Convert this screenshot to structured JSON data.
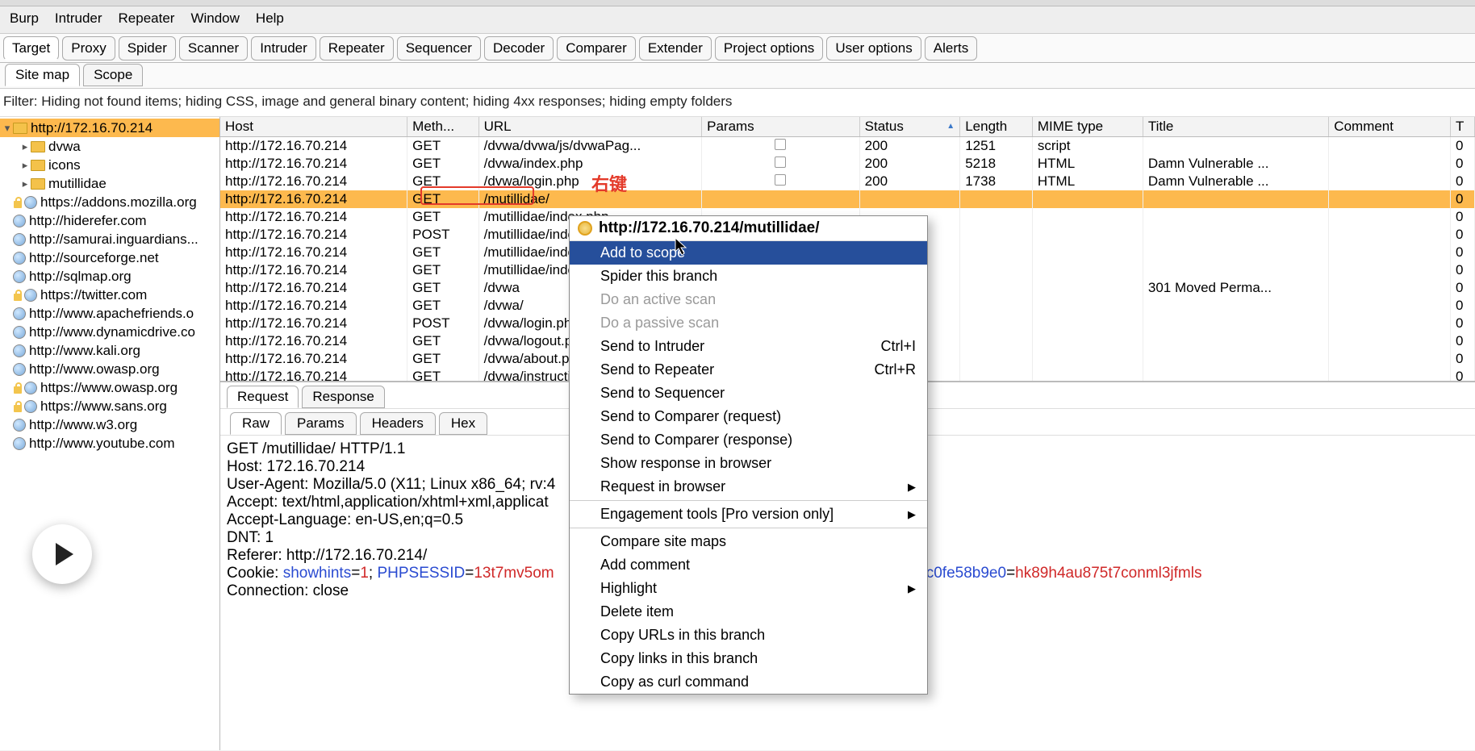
{
  "menu": {
    "burp": "Burp",
    "intruder": "Intruder",
    "repeater": "Repeater",
    "window": "Window",
    "help": "Help"
  },
  "tabs": [
    "Target",
    "Proxy",
    "Spider",
    "Scanner",
    "Intruder",
    "Repeater",
    "Sequencer",
    "Decoder",
    "Comparer",
    "Extender",
    "Project options",
    "User options",
    "Alerts"
  ],
  "active_tab_idx": 0,
  "subtabs": [
    "Site map",
    "Scope"
  ],
  "active_subtab_idx": 0,
  "filter_text": "Filter: Hiding not found items; hiding CSS, image and general binary content; hiding 4xx responses; hiding empty folders",
  "tree": [
    {
      "label": "http://172.16.70.214",
      "icon": "folder",
      "indent": 0,
      "tw": "▾",
      "sel": true,
      "lock": false
    },
    {
      "label": "dvwa",
      "icon": "folder",
      "indent": 1,
      "tw": "▸",
      "sel": false,
      "lock": false
    },
    {
      "label": "icons",
      "icon": "folder",
      "indent": 1,
      "tw": "▸",
      "sel": false,
      "lock": false
    },
    {
      "label": "mutillidae",
      "icon": "folder",
      "indent": 1,
      "tw": "▸",
      "sel": false,
      "lock": false
    },
    {
      "label": "https://addons.mozilla.org",
      "icon": "globe",
      "indent": 0,
      "tw": "",
      "sel": false,
      "lock": true
    },
    {
      "label": "http://hiderefer.com",
      "icon": "globe",
      "indent": 0,
      "tw": "",
      "sel": false,
      "lock": false
    },
    {
      "label": "http://samurai.inguardians...",
      "icon": "globe",
      "indent": 0,
      "tw": "",
      "sel": false,
      "lock": false
    },
    {
      "label": "http://sourceforge.net",
      "icon": "globe",
      "indent": 0,
      "tw": "",
      "sel": false,
      "lock": false
    },
    {
      "label": "http://sqlmap.org",
      "icon": "globe",
      "indent": 0,
      "tw": "",
      "sel": false,
      "lock": false
    },
    {
      "label": "https://twitter.com",
      "icon": "globe",
      "indent": 0,
      "tw": "",
      "sel": false,
      "lock": true
    },
    {
      "label": "http://www.apachefriends.o",
      "icon": "globe",
      "indent": 0,
      "tw": "",
      "sel": false,
      "lock": false
    },
    {
      "label": "http://www.dynamicdrive.co",
      "icon": "globe",
      "indent": 0,
      "tw": "",
      "sel": false,
      "lock": false
    },
    {
      "label": "http://www.kali.org",
      "icon": "globe",
      "indent": 0,
      "tw": "",
      "sel": false,
      "lock": false
    },
    {
      "label": "http://www.owasp.org",
      "icon": "globe",
      "indent": 0,
      "tw": "",
      "sel": false,
      "lock": false
    },
    {
      "label": "https://www.owasp.org",
      "icon": "globe",
      "indent": 0,
      "tw": "",
      "sel": false,
      "lock": true
    },
    {
      "label": "https://www.sans.org",
      "icon": "globe",
      "indent": 0,
      "tw": "",
      "sel": false,
      "lock": true
    },
    {
      "label": "http://www.w3.org",
      "icon": "globe",
      "indent": 0,
      "tw": "",
      "sel": false,
      "lock": false
    },
    {
      "label": "http://www.youtube.com",
      "icon": "globe",
      "indent": 0,
      "tw": "",
      "sel": false,
      "lock": false
    }
  ],
  "columns": {
    "host": "Host",
    "meth": "Meth...",
    "url": "URL",
    "par": "Params",
    "stat": "Status",
    "len": "Length",
    "mime": "MIME type",
    "title": "Title",
    "comment": "Comment",
    "t": "T"
  },
  "rows": [
    {
      "host": "http://172.16.70.214",
      "meth": "GET",
      "url": "/dvwa/dvwa/js/dvwaPag...",
      "par": true,
      "stat": "200",
      "len": "1251",
      "mime": "script",
      "title": "",
      "sel": false,
      "t": "0"
    },
    {
      "host": "http://172.16.70.214",
      "meth": "GET",
      "url": "/dvwa/index.php",
      "par": true,
      "stat": "200",
      "len": "5218",
      "mime": "HTML",
      "title": "Damn Vulnerable ...",
      "sel": false,
      "t": "0"
    },
    {
      "host": "http://172.16.70.214",
      "meth": "GET",
      "url": "/dvwa/login.php",
      "par": true,
      "stat": "200",
      "len": "1738",
      "mime": "HTML",
      "title": "Damn Vulnerable ...",
      "sel": false,
      "t": "0"
    },
    {
      "host": "http://172.16.70.214",
      "meth": "GET",
      "url": "/mutillidae/",
      "par": false,
      "stat": "",
      "len": "",
      "mime": "",
      "title": "",
      "sel": true,
      "t": "0"
    },
    {
      "host": "http://172.16.70.214",
      "meth": "GET",
      "url": "/mutillidae/index.php",
      "par": false,
      "stat": "",
      "len": "",
      "mime": "",
      "title": "",
      "sel": false,
      "t": "0"
    },
    {
      "host": "http://172.16.70.214",
      "meth": "POST",
      "url": "/mutillidae/index.php",
      "par": false,
      "stat": "",
      "len": "",
      "mime": "",
      "title": "",
      "sel": false,
      "t": "0"
    },
    {
      "host": "http://172.16.70.214",
      "meth": "GET",
      "url": "/mutillidae/index.php",
      "par": false,
      "stat": "",
      "len": "",
      "mime": "",
      "title": "",
      "sel": false,
      "t": "0"
    },
    {
      "host": "http://172.16.70.214",
      "meth": "GET",
      "url": "/mutillidae/index.php",
      "par": false,
      "stat": "",
      "len": "",
      "mime": "",
      "title": "",
      "sel": false,
      "t": "0"
    },
    {
      "host": "http://172.16.70.214",
      "meth": "GET",
      "url": "/dvwa",
      "par": false,
      "stat": "",
      "len": "",
      "mime": "",
      "title": "301 Moved Perma...",
      "sel": false,
      "t": "0"
    },
    {
      "host": "http://172.16.70.214",
      "meth": "GET",
      "url": "/dvwa/",
      "par": false,
      "stat": "",
      "len": "",
      "mime": "",
      "title": "",
      "sel": false,
      "t": "0"
    },
    {
      "host": "http://172.16.70.214",
      "meth": "POST",
      "url": "/dvwa/login.php",
      "par": false,
      "stat": "",
      "len": "",
      "mime": "",
      "title": "",
      "sel": false,
      "t": "0"
    },
    {
      "host": "http://172.16.70.214",
      "meth": "GET",
      "url": "/dvwa/logout.php",
      "par": false,
      "stat": "",
      "len": "",
      "mime": "",
      "title": "",
      "sel": false,
      "t": "0"
    },
    {
      "host": "http://172.16.70.214",
      "meth": "GET",
      "url": "/dvwa/about.php",
      "par": false,
      "stat": "",
      "len": "",
      "mime": "",
      "title": "",
      "sel": false,
      "t": "0"
    },
    {
      "host": "http://172.16.70.214",
      "meth": "GET",
      "url": "/dvwa/instructions.p",
      "par": false,
      "stat": "",
      "len": "",
      "mime": "",
      "title": "",
      "sel": false,
      "t": "0"
    }
  ],
  "reqtabs": [
    "Request",
    "Response"
  ],
  "active_reqtab_idx": 0,
  "rawtabs": [
    "Raw",
    "Params",
    "Headers",
    "Hex"
  ],
  "active_rawtab_idx": 0,
  "raw": {
    "line1": "GET /mutillidae/ HTTP/1.1",
    "line2": "Host: 172.16.70.214",
    "line3": "User-Agent: Mozilla/5.0 (X11; Linux x86_64; rv:4",
    "line4": "Accept: text/html,application/xhtml+xml,applicat",
    "line5": "Accept-Language: en-US,en;q=0.5",
    "line6": "DNT: 1",
    "line7": "Referer: http://172.16.70.214/",
    "cookie_lbl": "Cookie: ",
    "cookie_k1": "showhints",
    "cookie_v1": "1",
    "cookie_k2": "PHPSESSID",
    "cookie_v2": "13t7mv5om",
    "cookie_tail_k": "2c0fe58b9e0",
    "cookie_tail_v": "hk89h4au875t7conml3jfmls",
    "line9": "Connection: close"
  },
  "ctx": {
    "header": "http://172.16.70.214/mutillidae/",
    "items": [
      {
        "label": "Add to scope",
        "hl": true
      },
      {
        "label": "Spider this branch"
      },
      {
        "label": "Do an active scan",
        "disabled": true
      },
      {
        "label": "Do a passive scan",
        "disabled": true
      },
      {
        "label": "Send to Intruder",
        "shortcut": "Ctrl+I"
      },
      {
        "label": "Send to Repeater",
        "shortcut": "Ctrl+R"
      },
      {
        "label": "Send to Sequencer"
      },
      {
        "label": "Send to Comparer (request)"
      },
      {
        "label": "Send to Comparer (response)"
      },
      {
        "label": "Show response in browser"
      },
      {
        "label": "Request in browser",
        "submenu": true
      },
      {
        "sep": true
      },
      {
        "label": "Engagement tools [Pro version only]",
        "submenu": true
      },
      {
        "sep": true
      },
      {
        "label": "Compare site maps"
      },
      {
        "label": "Add comment"
      },
      {
        "label": "Highlight",
        "submenu": true
      },
      {
        "label": "Delete item"
      },
      {
        "label": "Copy URLs in this branch"
      },
      {
        "label": "Copy links in this branch"
      },
      {
        "label": "Copy as curl command"
      }
    ]
  },
  "annot_text": "右键"
}
